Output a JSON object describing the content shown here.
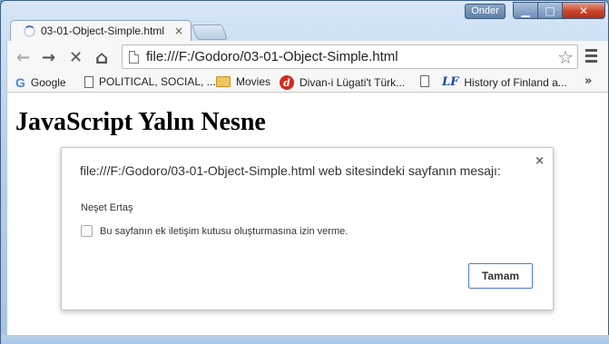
{
  "window": {
    "user_label": "Onder",
    "caption": {
      "minimize": "▁",
      "maximize": "□",
      "close": "✕"
    }
  },
  "tab": {
    "title": "03-01-Object-Simple.html",
    "close": "×"
  },
  "toolbar": {
    "back": "←",
    "forward": "→",
    "stop": "✕",
    "home": "⌂",
    "url": "file:///F:/Godoro/03-01-Object-Simple.html",
    "star": "☆"
  },
  "bookmarks": {
    "items": [
      {
        "label": "Google",
        "icon": "google-icon"
      },
      {
        "label": "POLITICAL, SOCIAL, ...",
        "icon": "page-icon"
      },
      {
        "label": "Movies",
        "icon": "folder-icon"
      },
      {
        "label": "Divan-i Lügati't Türk...",
        "icon": "divan-icon"
      },
      {
        "label": "",
        "icon": "page-icon"
      },
      {
        "label": "History of Finland a...",
        "icon": "lf-icon"
      }
    ],
    "more": "»"
  },
  "page": {
    "heading": "JavaScript Yalın Nesne"
  },
  "dialog": {
    "title": "file:///F:/Godoro/03-01-Object-Simple.html web sitesindeki sayfanın mesajı:",
    "close": "×",
    "message": "Neşet Ertaş",
    "checkbox_label": "Bu sayfanın ek iletişim kutusu oluşturmasına izin verme.",
    "checkbox_checked": false,
    "ok_label": "Tamam"
  }
}
